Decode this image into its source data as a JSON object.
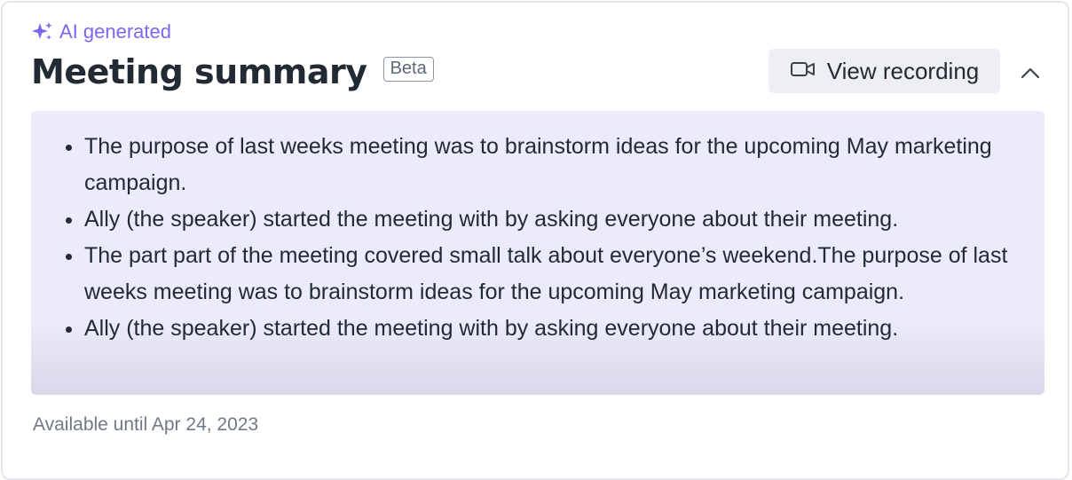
{
  "header": {
    "ai_label": "AI generated",
    "title": "Meeting summary",
    "badge": "Beta",
    "view_recording_label": "View recording",
    "icons": {
      "ai": "sparkle-icon",
      "recording": "video-camera-icon",
      "collapse": "chevron-up-icon"
    }
  },
  "summary": {
    "items": [
      "The purpose of last weeks meeting was to brainstorm ideas for the upcoming May marketing campaign.",
      "Ally (the speaker) started the meeting with by asking everyone about their meeting.",
      "The part part of the meeting covered small talk about everyone’s weekend.The purpose of last weeks meeting was to brainstorm ideas for the upcoming May marketing campaign.",
      "Ally (the speaker) started the meeting with by asking everyone about their meeting."
    ]
  },
  "footer": {
    "availability": "Available until Apr 24, 2023"
  },
  "colors": {
    "accent": "#7b68ee",
    "summary_bg": "#ebebfc",
    "text": "#222b33",
    "muted": "#6f7a85"
  }
}
